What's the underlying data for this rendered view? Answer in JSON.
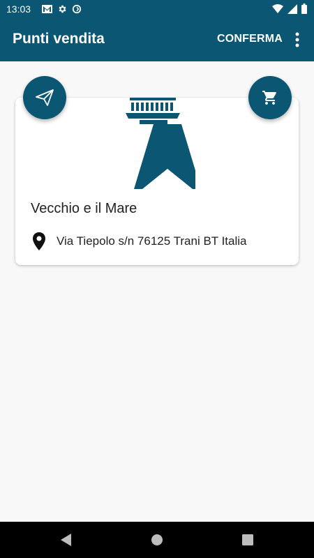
{
  "status_bar": {
    "time": "13:03",
    "left_icons": [
      "gmail-icon",
      "settings-gear-icon",
      "sync-icon"
    ],
    "right_icons": [
      "wifi-icon",
      "signal-icon",
      "battery-icon"
    ]
  },
  "app_bar": {
    "title": "Punti vendita",
    "confirm_label": "CONFERMA",
    "overflow_icon": "more-vertical-icon"
  },
  "store": {
    "name": "Vecchio e il Mare",
    "address": "Via Tiepolo s/n 76125 Trani BT Italia",
    "logo_icon": "lighthouse-logo",
    "address_icon": "location-pin-icon"
  },
  "actions": {
    "send_icon": "paper-plane-icon",
    "cart_icon": "shopping-cart-icon"
  },
  "nav_bar": {
    "icons": [
      "back-icon",
      "home-icon",
      "recents-icon"
    ]
  },
  "colors": {
    "primary": "#0b5672",
    "background": "#f8f8f8",
    "card": "#ffffff",
    "text": "#222222"
  }
}
